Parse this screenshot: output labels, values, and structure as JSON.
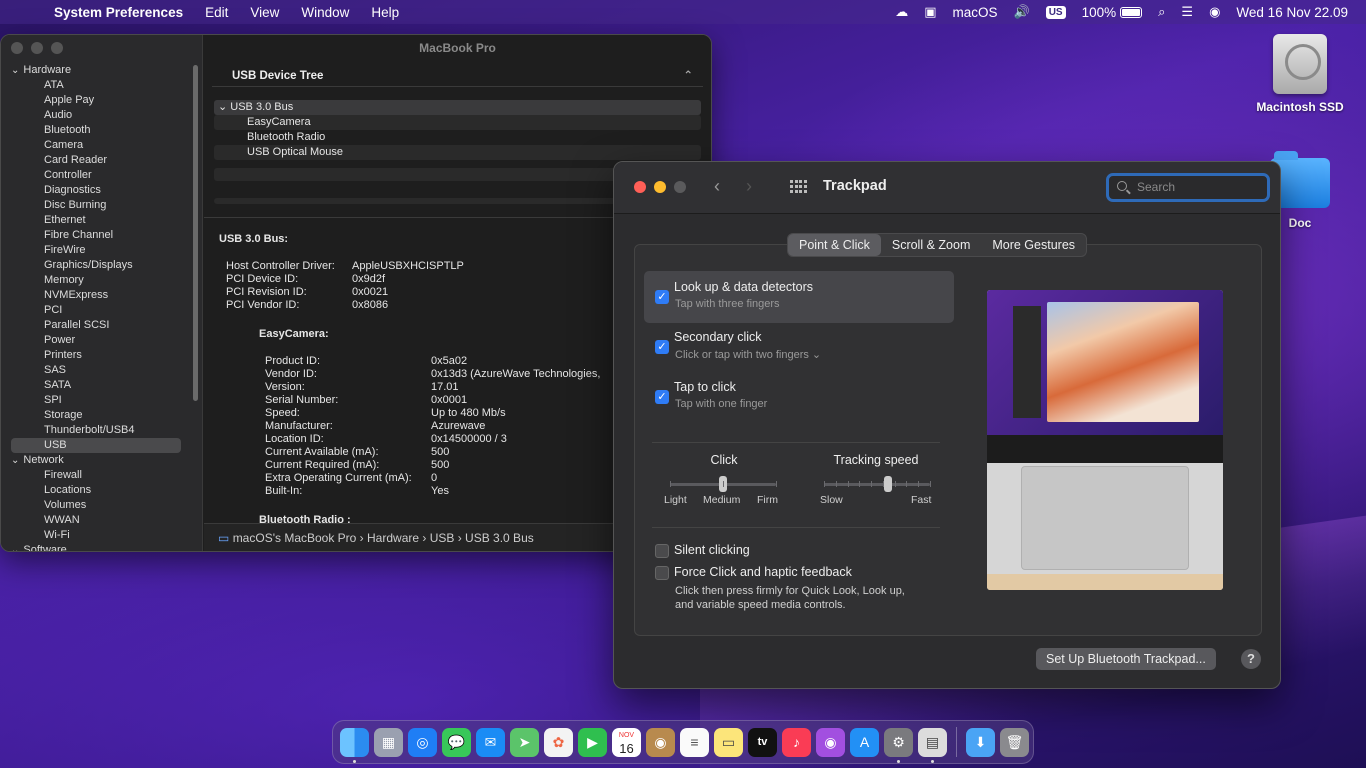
{
  "menubar": {
    "app_name": "System Preferences",
    "menus": [
      "Edit",
      "View",
      "Window",
      "Help"
    ],
    "input_label": "macOS",
    "keyboard_layout": "US",
    "battery_percent": "100%",
    "datetime": "Wed 16 Nov  22.09"
  },
  "desktop": {
    "icons": [
      {
        "label": "Macintosh SSD",
        "icon": "hard-drive-icon"
      },
      {
        "label": "Doc",
        "icon": "folder-icon"
      }
    ]
  },
  "sysinfo": {
    "window_title": "MacBook Pro",
    "sidebar": {
      "hardware_label": "Hardware",
      "hardware_items": [
        "ATA",
        "Apple Pay",
        "Audio",
        "Bluetooth",
        "Camera",
        "Card Reader",
        "Controller",
        "Diagnostics",
        "Disc Burning",
        "Ethernet",
        "Fibre Channel",
        "FireWire",
        "Graphics/Displays",
        "Memory",
        "NVMExpress",
        "PCI",
        "Parallel SCSI",
        "Power",
        "Printers",
        "SAS",
        "SATA",
        "SPI",
        "Storage",
        "Thunderbolt/USB4",
        "USB"
      ],
      "selected": "USB",
      "network_label": "Network",
      "network_items": [
        "Firewall",
        "Locations",
        "Volumes",
        "WWAN",
        "Wi-Fi"
      ],
      "software_label": "Software"
    },
    "tree_header": "USB Device Tree",
    "tree": {
      "bus": "USB 3.0 Bus",
      "devices": [
        "EasyCamera",
        "Bluetooth Radio",
        "USB Optical Mouse"
      ]
    },
    "details": {
      "heading": "USB 3.0 Bus:",
      "bus_props": [
        {
          "k": "Host Controller Driver:",
          "v": "AppleUSBXHCISPTLP"
        },
        {
          "k": "PCI Device ID:",
          "v": "0x9d2f"
        },
        {
          "k": "PCI Revision ID:",
          "v": "0x0021"
        },
        {
          "k": "PCI Vendor ID:",
          "v": "0x8086"
        }
      ],
      "device_heading": "EasyCamera:",
      "device_props": [
        {
          "k": "Product ID:",
          "v": "0x5a02"
        },
        {
          "k": "Vendor ID:",
          "v": "0x13d3  (AzureWave Technologies,"
        },
        {
          "k": "Version:",
          "v": "17.01"
        },
        {
          "k": "Serial Number:",
          "v": "0x0001"
        },
        {
          "k": "Speed:",
          "v": "Up to 480 Mb/s"
        },
        {
          "k": "Manufacturer:",
          "v": "Azurewave"
        },
        {
          "k": "Location ID:",
          "v": "0x14500000 / 3"
        },
        {
          "k": "Current Available (mA):",
          "v": "500"
        },
        {
          "k": "Current Required (mA):",
          "v": "500"
        },
        {
          "k": "Extra Operating Current (mA):",
          "v": "0"
        },
        {
          "k": "Built-In:",
          "v": "Yes"
        }
      ],
      "next_heading": "Bluetooth Radio :"
    },
    "pathbar": "macOS's MacBook Pro  ›  Hardware  ›  USB  ›  USB 3.0 Bus"
  },
  "trackpad": {
    "title": "Trackpad",
    "search_placeholder": "Search",
    "tabs": [
      "Point & Click",
      "Scroll & Zoom",
      "More Gestures"
    ],
    "active_tab": "Point & Click",
    "options": [
      {
        "title": "Look up & data detectors",
        "sub": "Tap with three fingers",
        "checked": true
      },
      {
        "title": "Secondary click",
        "sub": "Click or tap with two fingers ⌄",
        "checked": true
      },
      {
        "title": "Tap to click",
        "sub": "Tap with one finger",
        "checked": true
      }
    ],
    "click_slider": {
      "label": "Click",
      "min_label": "Light",
      "mid_label": "Medium",
      "max_label": "Firm",
      "value": 0.5
    },
    "speed_slider": {
      "label": "Tracking speed",
      "min_label": "Slow",
      "max_label": "Fast",
      "value": 0.6
    },
    "silent_clicking": {
      "label": "Silent clicking",
      "checked": false
    },
    "force_click": {
      "label": "Force Click and haptic feedback",
      "checked": false,
      "description_1": "Click then press firmly for Quick Look, Look up,",
      "description_2": "and variable speed media controls."
    },
    "bluetooth_button": "Set Up Bluetooth Trackpad...",
    "help": "?"
  },
  "dock": {
    "calendar_month": "NOV",
    "calendar_day": "16",
    "tv_label": "tv"
  }
}
